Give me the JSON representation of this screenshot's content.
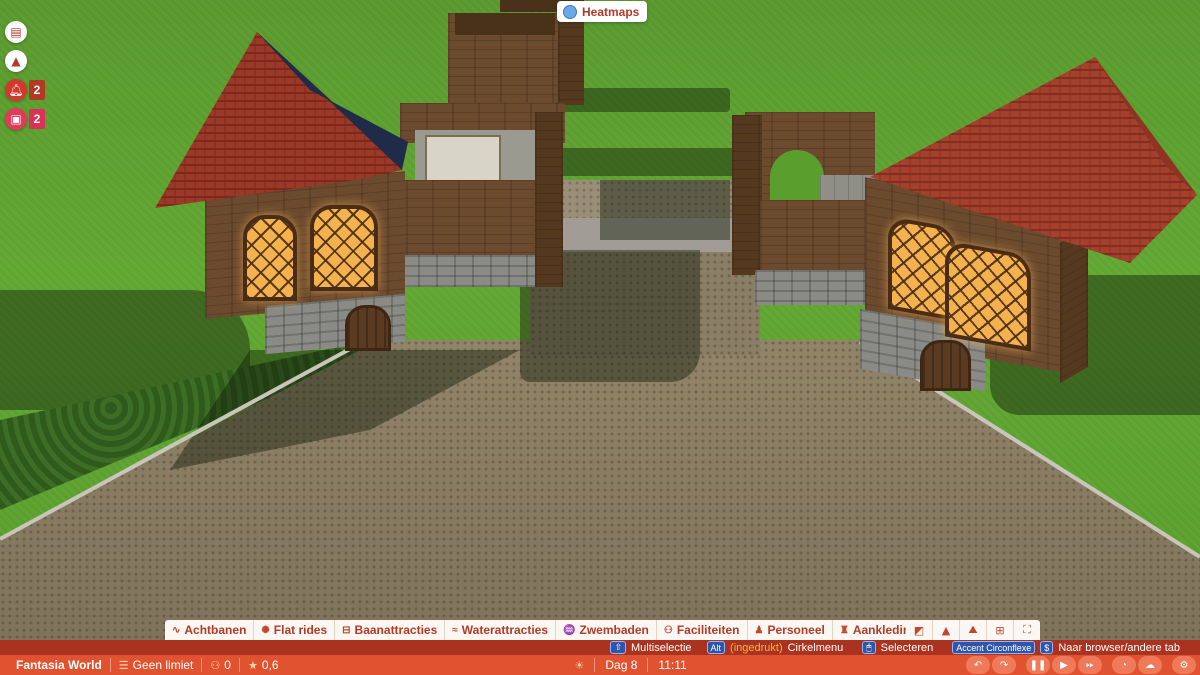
{
  "heatmaps_label": "Heatmaps",
  "side_buttons": [
    {
      "icon": "clipboard-icon",
      "count": ""
    },
    {
      "icon": "alert-plus-icon",
      "count": ""
    },
    {
      "icon": "bell-icon",
      "count": "2"
    },
    {
      "icon": "shop-icon",
      "count": "2"
    }
  ],
  "tabs": [
    {
      "label": "Achtbanen",
      "icon": "coaster-icon"
    },
    {
      "label": "Flat rides",
      "icon": "flat-ride-icon"
    },
    {
      "label": "Baanattracties",
      "icon": "track-ride-icon"
    },
    {
      "label": "Waterattracties",
      "icon": "water-ride-icon"
    },
    {
      "label": "Zwembaden",
      "icon": "pool-icon"
    },
    {
      "label": "Faciliteiten",
      "icon": "facilities-icon"
    },
    {
      "label": "Personeel",
      "icon": "staff-icon"
    },
    {
      "label": "Aankleding",
      "icon": "scenery-icon"
    }
  ],
  "tool_icons": [
    "building-icon",
    "terrain-paint-icon",
    "landscape-icon",
    "blueprint-icon",
    "fullscreen-icon"
  ],
  "hints": {
    "multiselect_key": "⇧",
    "multiselect": "Multiselectie",
    "alt_key": "Alt",
    "held": "(ingedrukt)",
    "circle_menu": "Cirkelmenu",
    "mouse_key": "🖱",
    "select": "Selecteren",
    "accent_key": "Accent Circonflexe",
    "dollar_key": "$",
    "browser": "Naar browser/andere tab"
  },
  "status": {
    "park_name": "Fantasia World",
    "money": "Geen limiet",
    "guests": "0",
    "rating": "0,6",
    "day": "Dag 8",
    "time": "11:11"
  },
  "controls": [
    "undo-icon",
    "redo-icon",
    "pause-icon",
    "play-icon",
    "fast-forward-icon",
    "speed-icon",
    "weather-icon",
    "settings-icon"
  ],
  "colors": {
    "accent": "#e05230",
    "hint_bar": "#a9331f",
    "tab_text": "#b23a28"
  }
}
